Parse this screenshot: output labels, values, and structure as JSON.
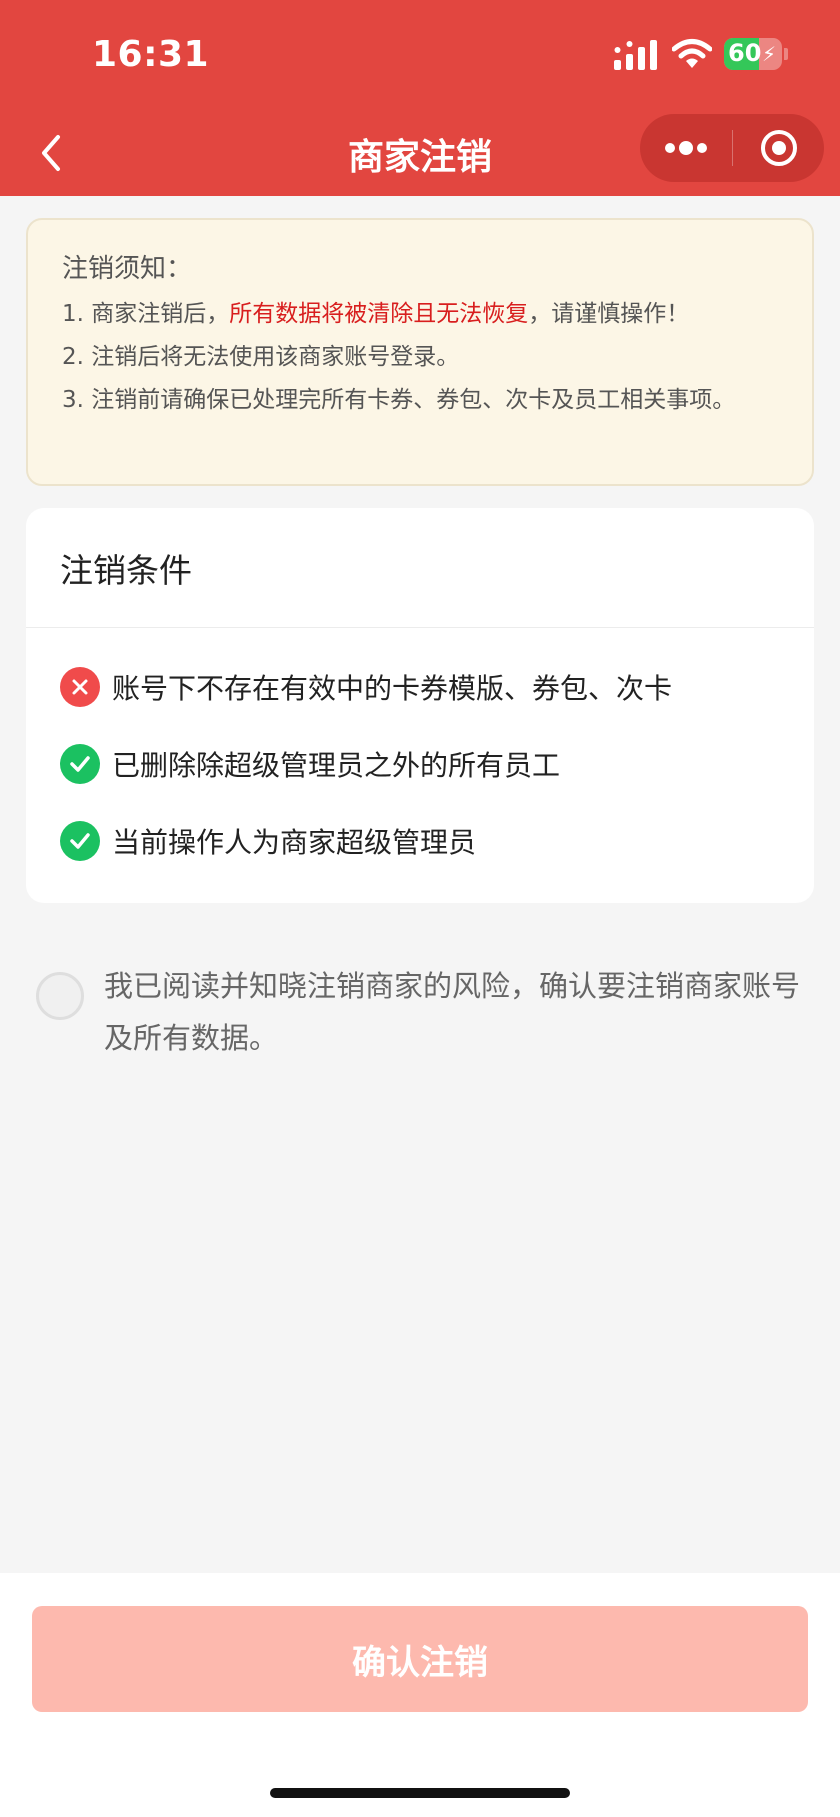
{
  "status_bar": {
    "time": "16:31",
    "battery_percent": "60",
    "battery_level": 0.6
  },
  "nav": {
    "title": "商家注销",
    "back_icon": "chevron-left-icon",
    "more_icon": "more-dots-icon",
    "close_icon": "target-circle-icon"
  },
  "notice": {
    "title": "注销须知：",
    "items": [
      {
        "prefix": "1. 商家注销后，",
        "warning": "所有数据将被清除且无法恢复",
        "suffix": "，请谨慎操作！"
      },
      {
        "text": "2. 注销后将无法使用该商家账号登录。"
      },
      {
        "text": "3. 注销前请确保已处理完所有卡券、券包、次卡及员工相关事项。"
      }
    ]
  },
  "conditions": {
    "title": "注销条件",
    "items": [
      {
        "status": "fail",
        "icon": "x-icon",
        "text": "账号下不存在有效中的卡券模版、券包、次卡"
      },
      {
        "status": "ok",
        "icon": "check-icon",
        "text": "已删除除超级管理员之外的所有员工"
      },
      {
        "status": "ok",
        "icon": "check-icon",
        "text": "当前操作人为商家超级管理员"
      }
    ]
  },
  "agreement": {
    "checked": false,
    "text": "我已阅读并知晓注销商家的风险，确认要注销商家账号及所有数据。"
  },
  "confirm_button": {
    "label": "确认注销",
    "disabled": true
  },
  "colors": {
    "header_bg": "#e24640",
    "warning_text": "#d81e1e",
    "fail": "#f04b4b",
    "ok": "#1bc161",
    "button_disabled": "#fdb9ae"
  }
}
